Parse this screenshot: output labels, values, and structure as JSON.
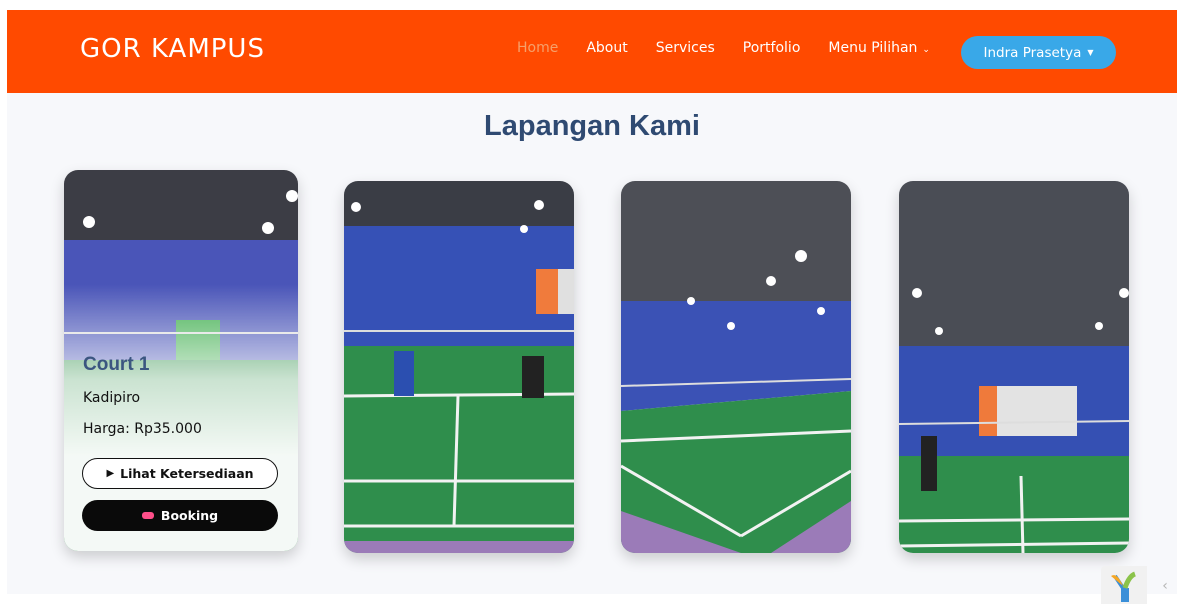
{
  "header": {
    "brand": "GOR KAMPUS",
    "nav": [
      {
        "label": "Home",
        "active": true
      },
      {
        "label": "About"
      },
      {
        "label": "Services"
      },
      {
        "label": "Portfolio"
      },
      {
        "label": "Menu Pilihan"
      }
    ],
    "user": "Indra Prasetya",
    "accent_color": "#ff4a00",
    "user_button_color": "#39a8e8"
  },
  "main": {
    "title": "Lapangan Kami",
    "cards": [
      {
        "name": "Court 1",
        "location": "Kadipiro",
        "price": "Harga: Rp35.000",
        "availability_label": "Lihat Ketersediaan",
        "booking_label": "Booking"
      }
    ]
  },
  "icons": [
    "play-icon",
    "ticket-icon",
    "chevron-down-icon",
    "caret-down-icon",
    "yii-logo-icon",
    "chevron-left-icon"
  ]
}
